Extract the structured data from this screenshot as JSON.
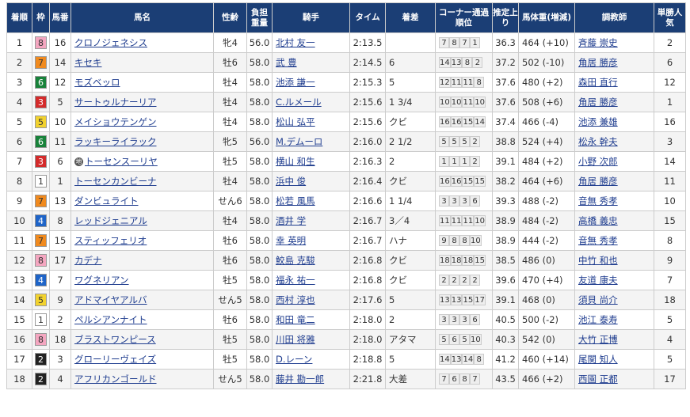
{
  "headers": [
    "着順",
    "枠",
    "馬番",
    "馬名",
    "性齢",
    "負担重量",
    "騎手",
    "タイム",
    "着差",
    "コーナー通過順位",
    "推定上り",
    "馬体重(増減)",
    "調教師",
    "単勝人気"
  ],
  "waku_colors": {
    "1": "#ffffff",
    "2": "#222222",
    "3": "#d42b2b",
    "4": "#1e64c8",
    "5": "#f2d22e",
    "6": "#18823a",
    "7": "#f08a1e",
    "8": "#f4a6c0"
  },
  "waku_text": {
    "1": "#333333",
    "2": "#ffffff",
    "3": "#ffffff",
    "4": "#ffffff",
    "5": "#333333",
    "6": "#ffffff",
    "7": "#333333",
    "8": "#333333"
  },
  "rows": [
    {
      "pos": "1",
      "waku": "8",
      "num": "16",
      "name": "クロノジェネシス",
      "sex": "牝4",
      "wt": "56.0",
      "jockey": "北村 友一",
      "time": "2:13.5",
      "margin": "",
      "corner": [
        "7",
        "8",
        "7",
        "1"
      ],
      "last": "36.3",
      "body": "464 (+10)",
      "trainer": "斉藤 崇史",
      "pop": "2",
      "mark": ""
    },
    {
      "pos": "2",
      "waku": "7",
      "num": "14",
      "name": "キセキ",
      "sex": "牡6",
      "wt": "58.0",
      "jockey": "武 豊",
      "time": "2:14.5",
      "margin": "6",
      "corner": [
        "14",
        "13",
        "8",
        "2"
      ],
      "last": "37.2",
      "body": "502 (-10)",
      "trainer": "角居 勝彦",
      "pop": "6",
      "mark": ""
    },
    {
      "pos": "3",
      "waku": "6",
      "num": "12",
      "name": "モズベッロ",
      "sex": "牡4",
      "wt": "58.0",
      "jockey": "池添 謙一",
      "time": "2:15.3",
      "margin": "5",
      "corner": [
        "12",
        "11",
        "11",
        "8"
      ],
      "last": "37.6",
      "body": "480 (+2)",
      "trainer": "森田 直行",
      "pop": "12",
      "mark": ""
    },
    {
      "pos": "4",
      "waku": "3",
      "num": "5",
      "name": "サートゥルナーリア",
      "sex": "牡4",
      "wt": "58.0",
      "jockey": "C.ルメール",
      "time": "2:15.6",
      "margin": "1 3/4",
      "corner": [
        "10",
        "10",
        "11",
        "10"
      ],
      "last": "37.6",
      "body": "508 (+6)",
      "trainer": "角居 勝彦",
      "pop": "1",
      "mark": ""
    },
    {
      "pos": "5",
      "waku": "5",
      "num": "10",
      "name": "メイショウテンゲン",
      "sex": "牡4",
      "wt": "58.0",
      "jockey": "松山 弘平",
      "time": "2:15.6",
      "margin": "クビ",
      "corner": [
        "16",
        "16",
        "15",
        "14"
      ],
      "last": "37.4",
      "body": "466 (-4)",
      "trainer": "池添 兼雄",
      "pop": "16",
      "mark": ""
    },
    {
      "pos": "6",
      "waku": "6",
      "num": "11",
      "name": "ラッキーライラック",
      "sex": "牝5",
      "wt": "56.0",
      "jockey": "M.デムーロ",
      "time": "2:16.0",
      "margin": "2 1/2",
      "corner": [
        "5",
        "5",
        "5",
        "2"
      ],
      "last": "38.8",
      "body": "524 (+4)",
      "trainer": "松永 幹夫",
      "pop": "3",
      "mark": ""
    },
    {
      "pos": "7",
      "waku": "3",
      "num": "6",
      "name": "トーセンスーリヤ",
      "sex": "牡5",
      "wt": "58.0",
      "jockey": "横山 和生",
      "time": "2:16.3",
      "margin": "2",
      "corner": [
        "1",
        "1",
        "1",
        "2"
      ],
      "last": "39.1",
      "body": "484 (+2)",
      "trainer": "小野 次郎",
      "pop": "14",
      "mark": "地"
    },
    {
      "pos": "8",
      "waku": "1",
      "num": "1",
      "name": "トーセンカンビーナ",
      "sex": "牡4",
      "wt": "58.0",
      "jockey": "浜中 俊",
      "time": "2:16.4",
      "margin": "クビ",
      "corner": [
        "16",
        "16",
        "15",
        "15"
      ],
      "last": "38.2",
      "body": "464 (+6)",
      "trainer": "角居 勝彦",
      "pop": "11",
      "mark": ""
    },
    {
      "pos": "9",
      "waku": "7",
      "num": "13",
      "name": "ダンビュライト",
      "sex": "せん6",
      "wt": "58.0",
      "jockey": "松若 風馬",
      "time": "2:16.6",
      "margin": "1 1/4",
      "corner": [
        "3",
        "3",
        "3",
        "6"
      ],
      "last": "39.3",
      "body": "488 (-2)",
      "trainer": "音無 秀孝",
      "pop": "10",
      "mark": ""
    },
    {
      "pos": "10",
      "waku": "4",
      "num": "8",
      "name": "レッドジェニアル",
      "sex": "牡4",
      "wt": "58.0",
      "jockey": "酒井 学",
      "time": "2:16.7",
      "margin": "3／4",
      "corner": [
        "11",
        "11",
        "11",
        "10"
      ],
      "last": "38.9",
      "body": "484 (-2)",
      "trainer": "高橋 義忠",
      "pop": "15",
      "mark": ""
    },
    {
      "pos": "11",
      "waku": "7",
      "num": "15",
      "name": "スティッフェリオ",
      "sex": "牡6",
      "wt": "58.0",
      "jockey": "幸 英明",
      "time": "2:16.7",
      "margin": "ハナ",
      "corner": [
        "9",
        "8",
        "8",
        "10"
      ],
      "last": "38.9",
      "body": "444 (-2)",
      "trainer": "音無 秀孝",
      "pop": "8",
      "mark": ""
    },
    {
      "pos": "12",
      "waku": "8",
      "num": "17",
      "name": "カデナ",
      "sex": "牡6",
      "wt": "58.0",
      "jockey": "鮫島 克駿",
      "time": "2:16.8",
      "margin": "クビ",
      "corner": [
        "18",
        "18",
        "18",
        "15"
      ],
      "last": "38.5",
      "body": "486 (0)",
      "trainer": "中竹 和也",
      "pop": "9",
      "mark": ""
    },
    {
      "pos": "13",
      "waku": "4",
      "num": "7",
      "name": "ワグネリアン",
      "sex": "牡5",
      "wt": "58.0",
      "jockey": "福永 祐一",
      "time": "2:16.8",
      "margin": "クビ",
      "corner": [
        "2",
        "2",
        "2",
        "2"
      ],
      "last": "39.6",
      "body": "470 (+4)",
      "trainer": "友道 康夫",
      "pop": "7",
      "mark": ""
    },
    {
      "pos": "14",
      "waku": "5",
      "num": "9",
      "name": "アドマイヤアルバ",
      "sex": "せん5",
      "wt": "58.0",
      "jockey": "西村 淳也",
      "time": "2:17.6",
      "margin": "5",
      "corner": [
        "13",
        "13",
        "15",
        "17"
      ],
      "last": "39.1",
      "body": "468 (0)",
      "trainer": "須貝 尚介",
      "pop": "18",
      "mark": ""
    },
    {
      "pos": "15",
      "waku": "1",
      "num": "2",
      "name": "ペルシアンナイト",
      "sex": "牡6",
      "wt": "58.0",
      "jockey": "和田 竜二",
      "time": "2:18.0",
      "margin": "2",
      "corner": [
        "3",
        "3",
        "3",
        "6"
      ],
      "last": "40.5",
      "body": "500 (-2)",
      "trainer": "池江 泰寿",
      "pop": "5",
      "mark": ""
    },
    {
      "pos": "16",
      "waku": "8",
      "num": "18",
      "name": "ブラストワンピース",
      "sex": "牡5",
      "wt": "58.0",
      "jockey": "川田 将雅",
      "time": "2:18.0",
      "margin": "アタマ",
      "corner": [
        "5",
        "6",
        "5",
        "10"
      ],
      "last": "40.3",
      "body": "542 (0)",
      "trainer": "大竹 正博",
      "pop": "4",
      "mark": ""
    },
    {
      "pos": "17",
      "waku": "2",
      "num": "3",
      "name": "グローリーヴェイズ",
      "sex": "牡5",
      "wt": "58.0",
      "jockey": "D.レーン",
      "time": "2:18.8",
      "margin": "5",
      "corner": [
        "14",
        "13",
        "14",
        "8"
      ],
      "last": "41.2",
      "body": "460 (+14)",
      "trainer": "尾関 知人",
      "pop": "5",
      "mark": ""
    },
    {
      "pos": "18",
      "waku": "2",
      "num": "4",
      "name": "アフリカンゴールド",
      "sex": "せん5",
      "wt": "58.0",
      "jockey": "藤井 勘一郎",
      "time": "2:21.8",
      "margin": "大差",
      "corner": [
        "7",
        "6",
        "8",
        "7"
      ],
      "last": "43.5",
      "body": "466 (+2)",
      "trainer": "西園 正都",
      "pop": "17",
      "mark": ""
    }
  ]
}
